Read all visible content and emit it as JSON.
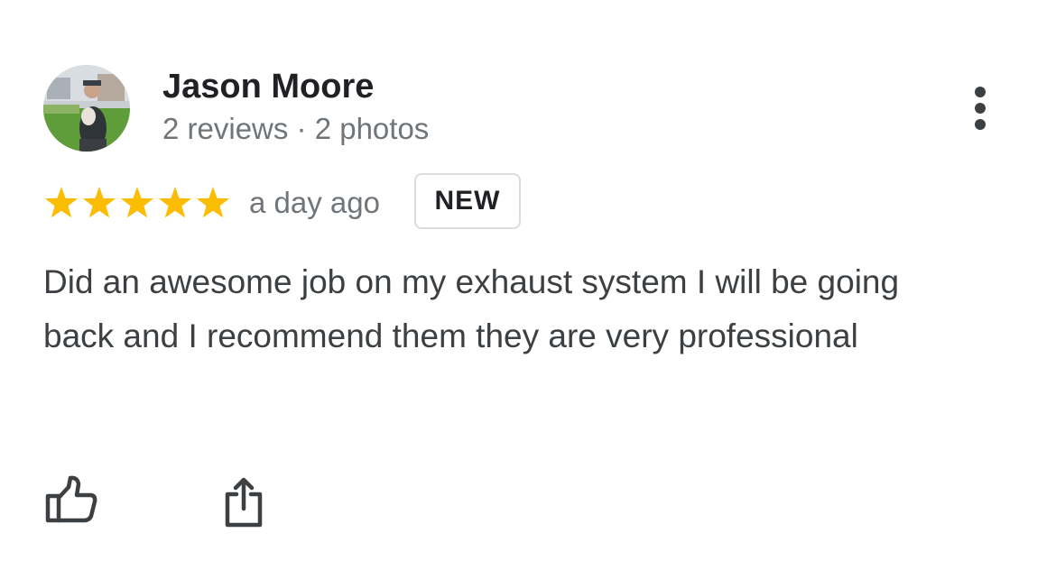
{
  "review": {
    "author": {
      "name": "Jason Moore",
      "meta": "2 reviews · 2 photos",
      "avatar_icon": "profile-photo"
    },
    "rating": {
      "stars": 5,
      "max_stars": 5,
      "star_color": "#fbbc04"
    },
    "time_ago": "a day ago",
    "badge": "NEW",
    "text": "Did an awesome job on my exhaust system I will be going back and I recommend them they are very professional",
    "actions": {
      "like_icon": "thumbs-up-icon",
      "share_icon": "share-icon",
      "more_icon": "more-vert-icon"
    }
  }
}
